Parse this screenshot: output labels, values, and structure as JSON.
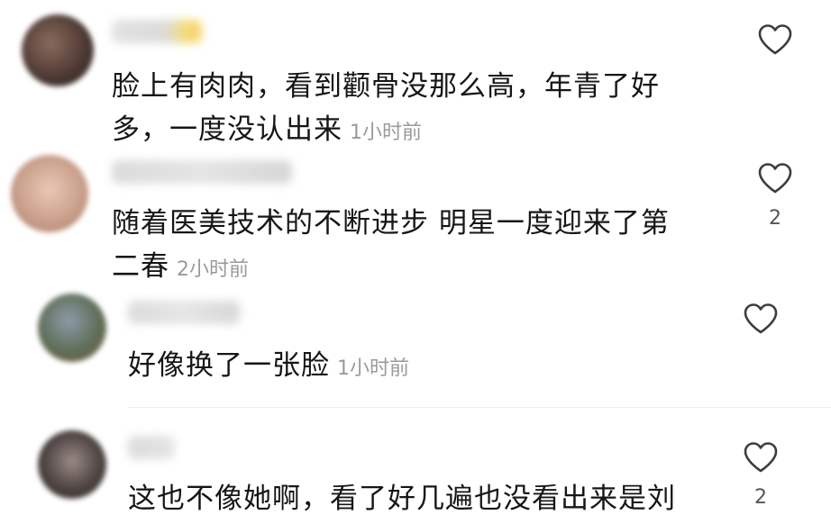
{
  "comments": [
    {
      "text_line1": "脸上有肉肉，看到颧骨没那么高，年青了好",
      "text_line2": "多，一度没认出来",
      "time": "1小时前",
      "likes": ""
    },
    {
      "text_line1": "随着医美技术的不断进步 明星一度迎来了第",
      "text_line2": "二春",
      "time": "2小时前",
      "likes": "2"
    },
    {
      "text_line1": "好像换了一张脸",
      "time": "1小时前",
      "likes": ""
    },
    {
      "text_line1": "这也不像她啊，看了好几遍也没看出来是刘",
      "likes": "2"
    }
  ]
}
